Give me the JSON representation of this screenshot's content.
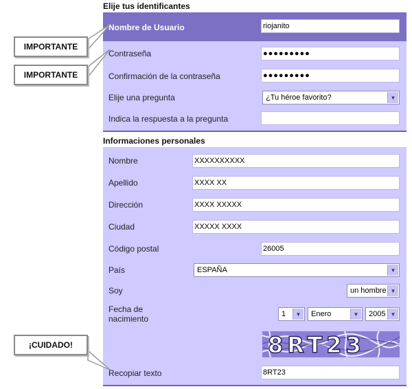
{
  "section1": {
    "title": "Elije tus identificantes",
    "username_label": "Nombre de Usuario",
    "username_value": "riojanito",
    "password_label": "Contraseña",
    "password_value": "●●●●●●●●●",
    "confirm_label": "Confirmación de la contraseña",
    "confirm_value": "●●●●●●●●●",
    "question_label": "Elije una pregunta",
    "question_value": "¿Tu héroe favorito?",
    "answer_label": "Indica la respuesta a la pregunta",
    "answer_value": ""
  },
  "section2": {
    "title": "Informaciones personales",
    "nombre_label": "Nombre",
    "nombre_value": "XXXXXXXXXX",
    "apellido_label": "Apellido",
    "apellido_value": "XXXX XX",
    "direccion_label": "Dirección",
    "direccion_value": "XXXX XXXXX",
    "ciudad_label": "Ciudad",
    "ciudad_value": "XXXXX XXXX",
    "cp_label": "Código postal",
    "cp_value": "26005",
    "pais_label": "País",
    "pais_value": "ESPAÑA",
    "soy_label": "Soy",
    "soy_value": "un hombre",
    "fecha_label_1": "Fecha de",
    "fecha_label_2": "nacimiento",
    "dia_value": "1",
    "mes_value": "Enero",
    "anio_value": "2005",
    "captcha_text": "8RT23",
    "recopiar_label": "Recopiar texto",
    "recopiar_value": "8RT23"
  },
  "callouts": {
    "importante_1": "IMPORTANTE",
    "importante_2": "IMPORTANTE",
    "cuidado": "¡CUIDADO!"
  },
  "colors": {
    "panel": "#cfcaff",
    "header": "#7b70c4",
    "rule": "#6e62b8"
  }
}
